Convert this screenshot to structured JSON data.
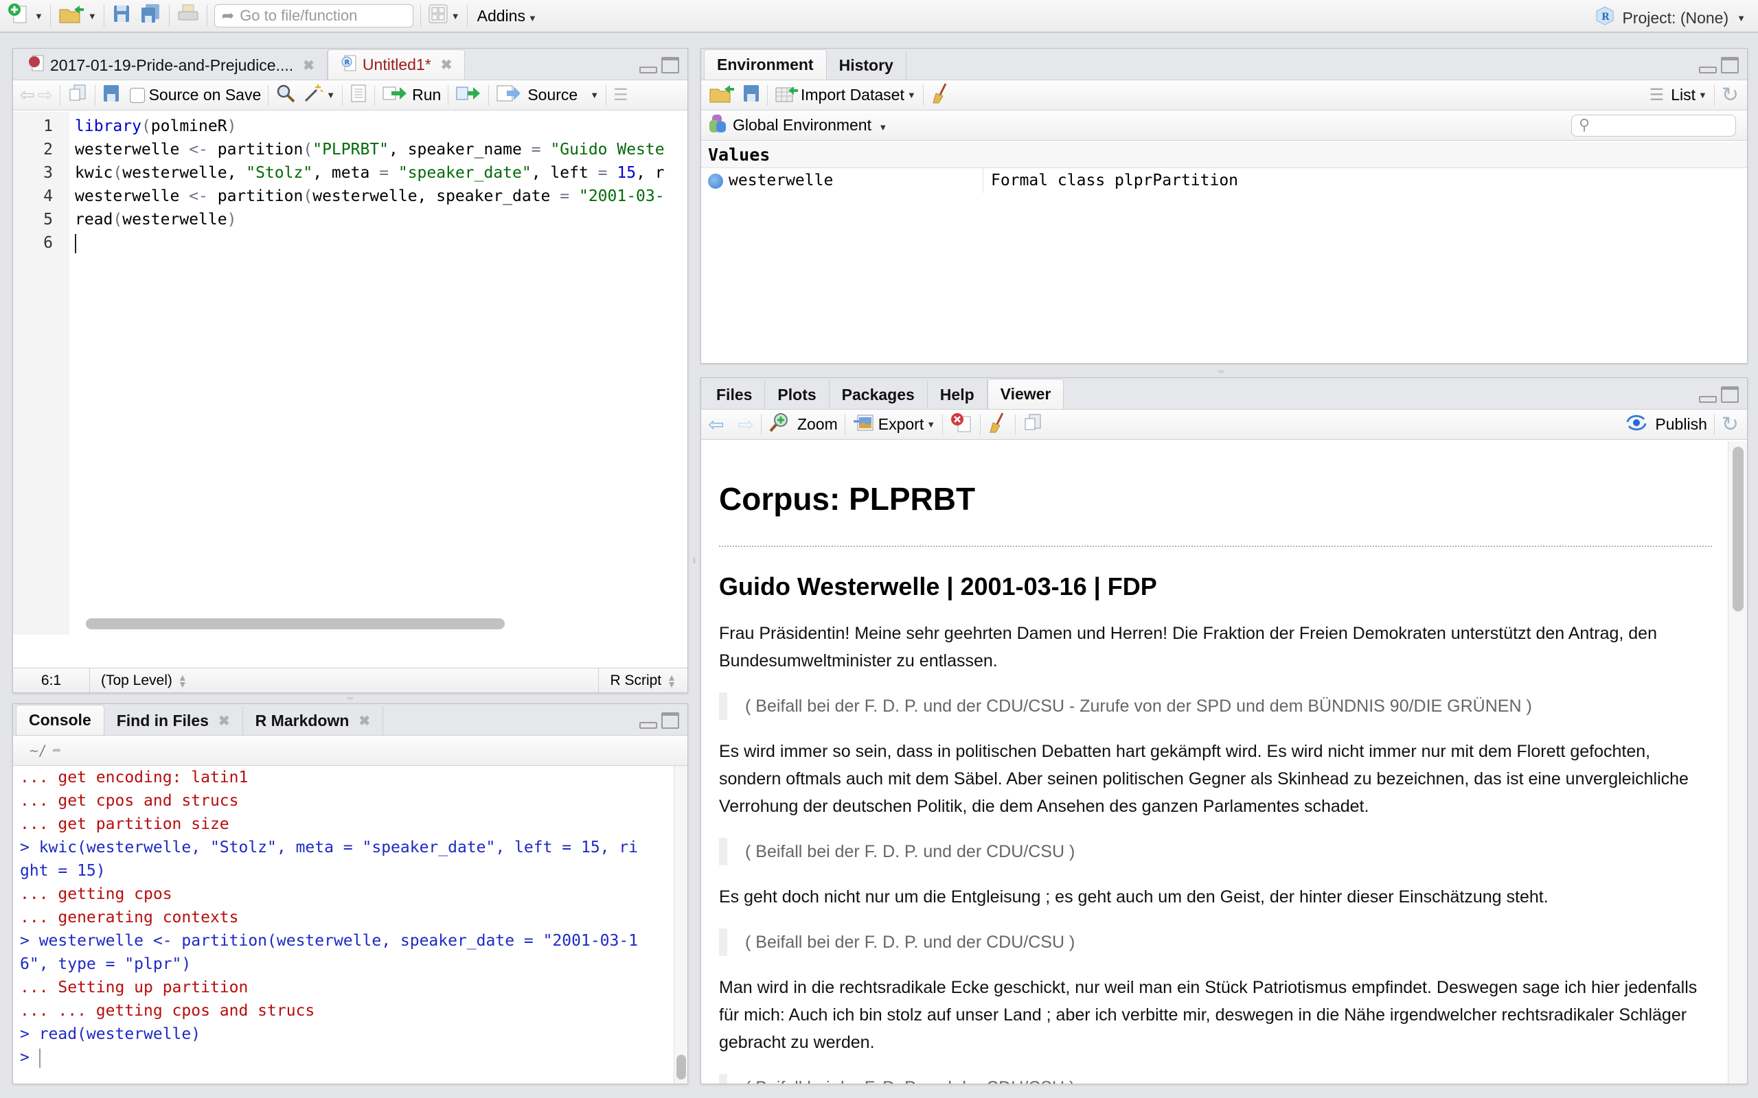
{
  "topbar": {
    "goto_placeholder": "Go to file/function",
    "addins_label": "Addins",
    "project_label": "Project: (None)"
  },
  "editor": {
    "tabs": [
      {
        "label": "2017-01-19-Pride-and-Prejudice....",
        "active": false,
        "modified": false
      },
      {
        "label": "Untitled1*",
        "active": true,
        "modified": true
      }
    ],
    "toolbar": {
      "source_on_save_label": "Source on Save",
      "source_on_save_checked": false,
      "run_label": "Run",
      "source_label": "Source"
    },
    "lines": [
      {
        "n": "1",
        "tokens": [
          [
            "kw",
            "library"
          ],
          [
            "paren",
            "("
          ],
          [
            "",
            "polmineR"
          ],
          [
            "paren",
            ")"
          ]
        ]
      },
      {
        "n": "2",
        "tokens": [
          [
            "",
            "westerwelle "
          ],
          [
            "op",
            "<-"
          ],
          [
            "",
            " partition"
          ],
          [
            "paren",
            "("
          ],
          [
            "str",
            "\"PLPRBT\""
          ],
          [
            "",
            ", speaker_name "
          ],
          [
            "op",
            "="
          ],
          [
            "",
            " "
          ],
          [
            "str",
            "\"Guido Weste"
          ]
        ]
      },
      {
        "n": "3",
        "tokens": [
          [
            "",
            "kwic"
          ],
          [
            "paren",
            "("
          ],
          [
            "",
            "westerwelle, "
          ],
          [
            "str",
            "\"Stolz\""
          ],
          [
            "",
            ", meta "
          ],
          [
            "op",
            "="
          ],
          [
            "",
            " "
          ],
          [
            "str",
            "\"speaker_date\""
          ],
          [
            "",
            ", left "
          ],
          [
            "op",
            "="
          ],
          [
            "",
            " "
          ],
          [
            "num",
            "15"
          ],
          [
            "",
            ", r"
          ]
        ]
      },
      {
        "n": "4",
        "tokens": [
          [
            "",
            "westerwelle "
          ],
          [
            "op",
            "<-"
          ],
          [
            "",
            " partition"
          ],
          [
            "paren",
            "("
          ],
          [
            "",
            "westerwelle, speaker_date "
          ],
          [
            "op",
            "="
          ],
          [
            "",
            " "
          ],
          [
            "str",
            "\"2001-03-"
          ]
        ]
      },
      {
        "n": "5",
        "tokens": [
          [
            "",
            "read"
          ],
          [
            "paren",
            "("
          ],
          [
            "",
            "westerwelle"
          ],
          [
            "paren",
            ")"
          ]
        ]
      },
      {
        "n": "6",
        "tokens": []
      }
    ],
    "status": {
      "position": "6:1",
      "scope": "(Top Level)",
      "filetype": "R Script"
    }
  },
  "console": {
    "tabs": [
      {
        "label": "Console",
        "active": true,
        "closable": false
      },
      {
        "label": "Find in Files",
        "active": false,
        "closable": true
      },
      {
        "label": "R Markdown",
        "active": false,
        "closable": true
      }
    ],
    "path": "~/",
    "lines": [
      {
        "type": "msg",
        "text": "... get encoding: latin1"
      },
      {
        "type": "msg",
        "text": "... get cpos and strucs"
      },
      {
        "type": "msg",
        "text": "... get partition size"
      },
      {
        "type": "cmd",
        "text": "> kwic(westerwelle, \"Stolz\", meta = \"speaker_date\", left = 15, ri"
      },
      {
        "type": "cmd",
        "text": "ght = 15)"
      },
      {
        "type": "msg",
        "text": "... getting cpos"
      },
      {
        "type": "msg",
        "text": "... generating contexts"
      },
      {
        "type": "cmd",
        "text": "> westerwelle <- partition(westerwelle, speaker_date = \"2001-03-1"
      },
      {
        "type": "cmd",
        "text": "6\", type = \"plpr\")"
      },
      {
        "type": "msg",
        "text": "... Setting up partition"
      },
      {
        "type": "msg",
        "text": "... ... getting cpos and strucs"
      },
      {
        "type": "cmd",
        "text": "> read(westerwelle)"
      }
    ],
    "prompt": ">"
  },
  "environment": {
    "tabs": [
      {
        "label": "Environment",
        "active": true
      },
      {
        "label": "History",
        "active": false
      }
    ],
    "toolbar": {
      "import_label": "Import Dataset",
      "list_label": "List"
    },
    "scope_label": "Global Environment",
    "search_value": "",
    "section": "Values",
    "rows": [
      {
        "name": "westerwelle",
        "value": "Formal class plprPartition"
      }
    ]
  },
  "viewer": {
    "tabs": [
      {
        "label": "Files",
        "active": false
      },
      {
        "label": "Plots",
        "active": false
      },
      {
        "label": "Packages",
        "active": false
      },
      {
        "label": "Help",
        "active": false
      },
      {
        "label": "Viewer",
        "active": true
      }
    ],
    "toolbar": {
      "zoom_label": "Zoom",
      "export_label": "Export",
      "publish_label": "Publish"
    },
    "doc": {
      "title": "Corpus: PLPRBT",
      "subtitle": "Guido Westerwelle | 2001-03-16 | FDP",
      "blocks": [
        {
          "type": "p",
          "text": "Frau Präsidentin! Meine sehr geehrten Damen und Herren! Die Fraktion der Freien Demokraten unterstützt den Antrag, den Bundesumweltminister zu entlassen."
        },
        {
          "type": "q",
          "text": "( Beifall bei der F. D. P. und der CDU/CSU - Zurufe von der SPD und dem BÜNDNIS 90/DIE GRÜNEN )"
        },
        {
          "type": "p",
          "text": "Es wird immer so sein, dass in politischen Debatten hart gekämpft wird. Es wird nicht immer nur mit dem Florett gefochten, sondern oftmals auch mit dem Säbel. Aber seinen politischen Gegner als Skinhead zu bezeichnen, das ist eine unvergleichliche Verrohung der deutschen Politik, die dem Ansehen des ganzen Parlamentes schadet."
        },
        {
          "type": "q",
          "text": "( Beifall bei der F. D. P. und der CDU/CSU )"
        },
        {
          "type": "p",
          "text": "Es geht doch nicht nur um die Entgleisung ; es geht auch um den Geist, der hinter dieser Einschätzung steht."
        },
        {
          "type": "q",
          "text": "( Beifall bei der F. D. P. und der CDU/CSU )"
        },
        {
          "type": "p",
          "text": "Man wird in die rechtsradikale Ecke geschickt, nur weil man ein Stück Patriotismus empfindet. Deswegen sage ich hier jedenfalls für mich: Auch ich bin stolz auf unser Land ; aber ich verbitte mir, deswegen in die Nähe irgendwelcher rechtsradikaler Schläger gebracht zu werden."
        },
        {
          "type": "q",
          "text": "( Beifall bei der F. D. P. und der CDU/CSU )"
        }
      ]
    }
  },
  "colors": {
    "console_message": "#b80d0d",
    "console_command": "#1d29c5",
    "code_string": "#036a07",
    "code_keyword": "#0000cc",
    "modified_tab": "#9a1a1a"
  }
}
